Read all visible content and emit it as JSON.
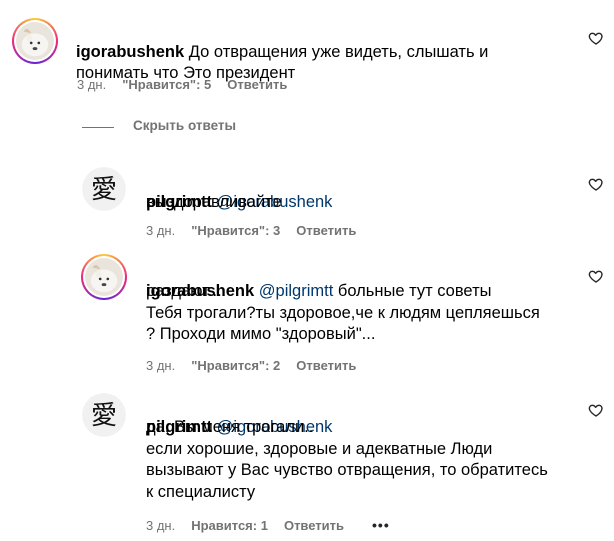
{
  "comments": [
    {
      "username": "igorabushenk",
      "mention": "",
      "text": "До отвращения уже видеть, слышать и\nпонимать что Это президент",
      "time": "3 дн.",
      "likes": "\"Нравится\": 5",
      "reply": "Ответить"
    },
    {
      "username": "pilgrimtt",
      "mention": "@igorabushenk",
      "text": "выздоравливайте",
      "time": "3 дн.",
      "likes": "\"Нравится\": 3",
      "reply": "Ответить"
    },
    {
      "username": "igorabushenk",
      "mention": "@pilgrimtt",
      "text_inline": "больные тут советы",
      "text": "раздают...\nТебя трогали?ты здоровое,че к людям цепляешься\n? Проходи мимо \"здоровый\"...",
      "time": "3 дн.",
      "likes": "\"Нравится\": 2",
      "reply": "Ответить"
    },
    {
      "username": "pilgrimtt",
      "mention": "@igorabushenk",
      "text": "да, Вы меня трогали..\nесли хорошие, здоровые и адекватные Люди\nвызывают у Вас чувство отвращения, то обратитесь\nк специалисту",
      "time": "3 дн.",
      "likes": "Нравится: 1",
      "reply": "Ответить",
      "more": "•••"
    }
  ],
  "hide_replies": "Скрыть ответы",
  "colors": {
    "meta": "#737373",
    "mention": "#00376b"
  }
}
